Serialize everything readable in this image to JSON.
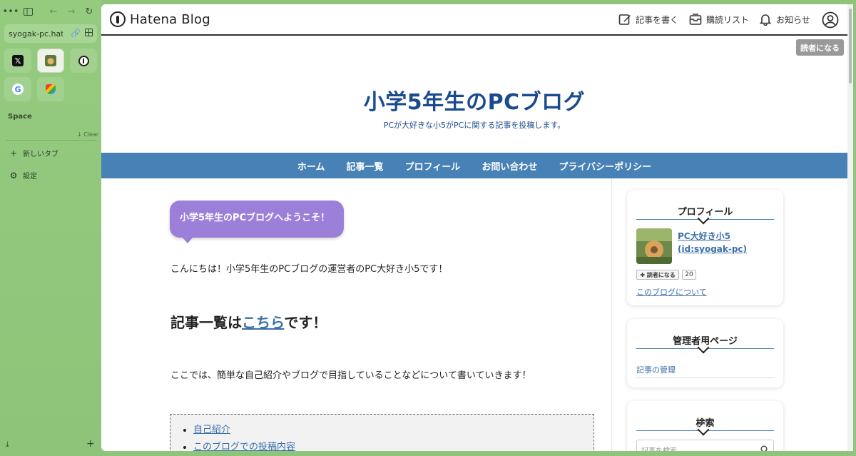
{
  "browser": {
    "url": "syogak-pc.hatenablog.com",
    "space_label": "Space",
    "clear_label": "↓ Clear",
    "new_tab_label": "新しいタブ",
    "settings_label": "設定",
    "pinned": [
      "x-icon",
      "blog-favicon",
      "1password-icon",
      "google-icon",
      "maps-icon"
    ]
  },
  "hatena": {
    "logo_text": "Hatena Blog",
    "write_label": "記事を書く",
    "reading_list_label": "購読リスト",
    "notifications_label": "お知らせ",
    "subscribe_label": "読者になる"
  },
  "blog": {
    "title": "小学5年生のPCブログ",
    "description": "PCが大好きな小5がPCに関する記事を投稿します。",
    "nav": [
      "ホーム",
      "記事一覧",
      "プロフィール",
      "お問い合わせ",
      "プライバシーポリシー"
    ]
  },
  "article": {
    "bubble": "小学5年生のPCブログへようこそ！",
    "intro": "こんにちは！小学5年生のPCブログの運営者のPC大好き小5です！",
    "list_heading_prefix": "記事一覧は",
    "list_heading_link": "こちら",
    "list_heading_suffix": "です！",
    "para2": "ここでは、簡単な自己紹介やブログで目指していることなどについて書いていきます！",
    "toc": [
      "自己紹介",
      "このブログでの投稿内容"
    ]
  },
  "sidebar": {
    "profile_title": "プロフィール",
    "profile_name": "PC大好き小5 (id:syogak-pc)",
    "follow_label": "✚ 読者になる",
    "follow_count": "20",
    "about_link": "このブログについて",
    "admin_title": "管理者用ページ",
    "admin_link": "記事の管理",
    "search_title": "検索",
    "search_placeholder": "記事を検索"
  },
  "colors": {
    "title_blue": "#1b4b8f",
    "nav_blue": "#4781b5",
    "bubble_purple": "#9b7fd9",
    "link_blue": "#3a6fa8",
    "sidebar_green": "#8fc47a"
  }
}
